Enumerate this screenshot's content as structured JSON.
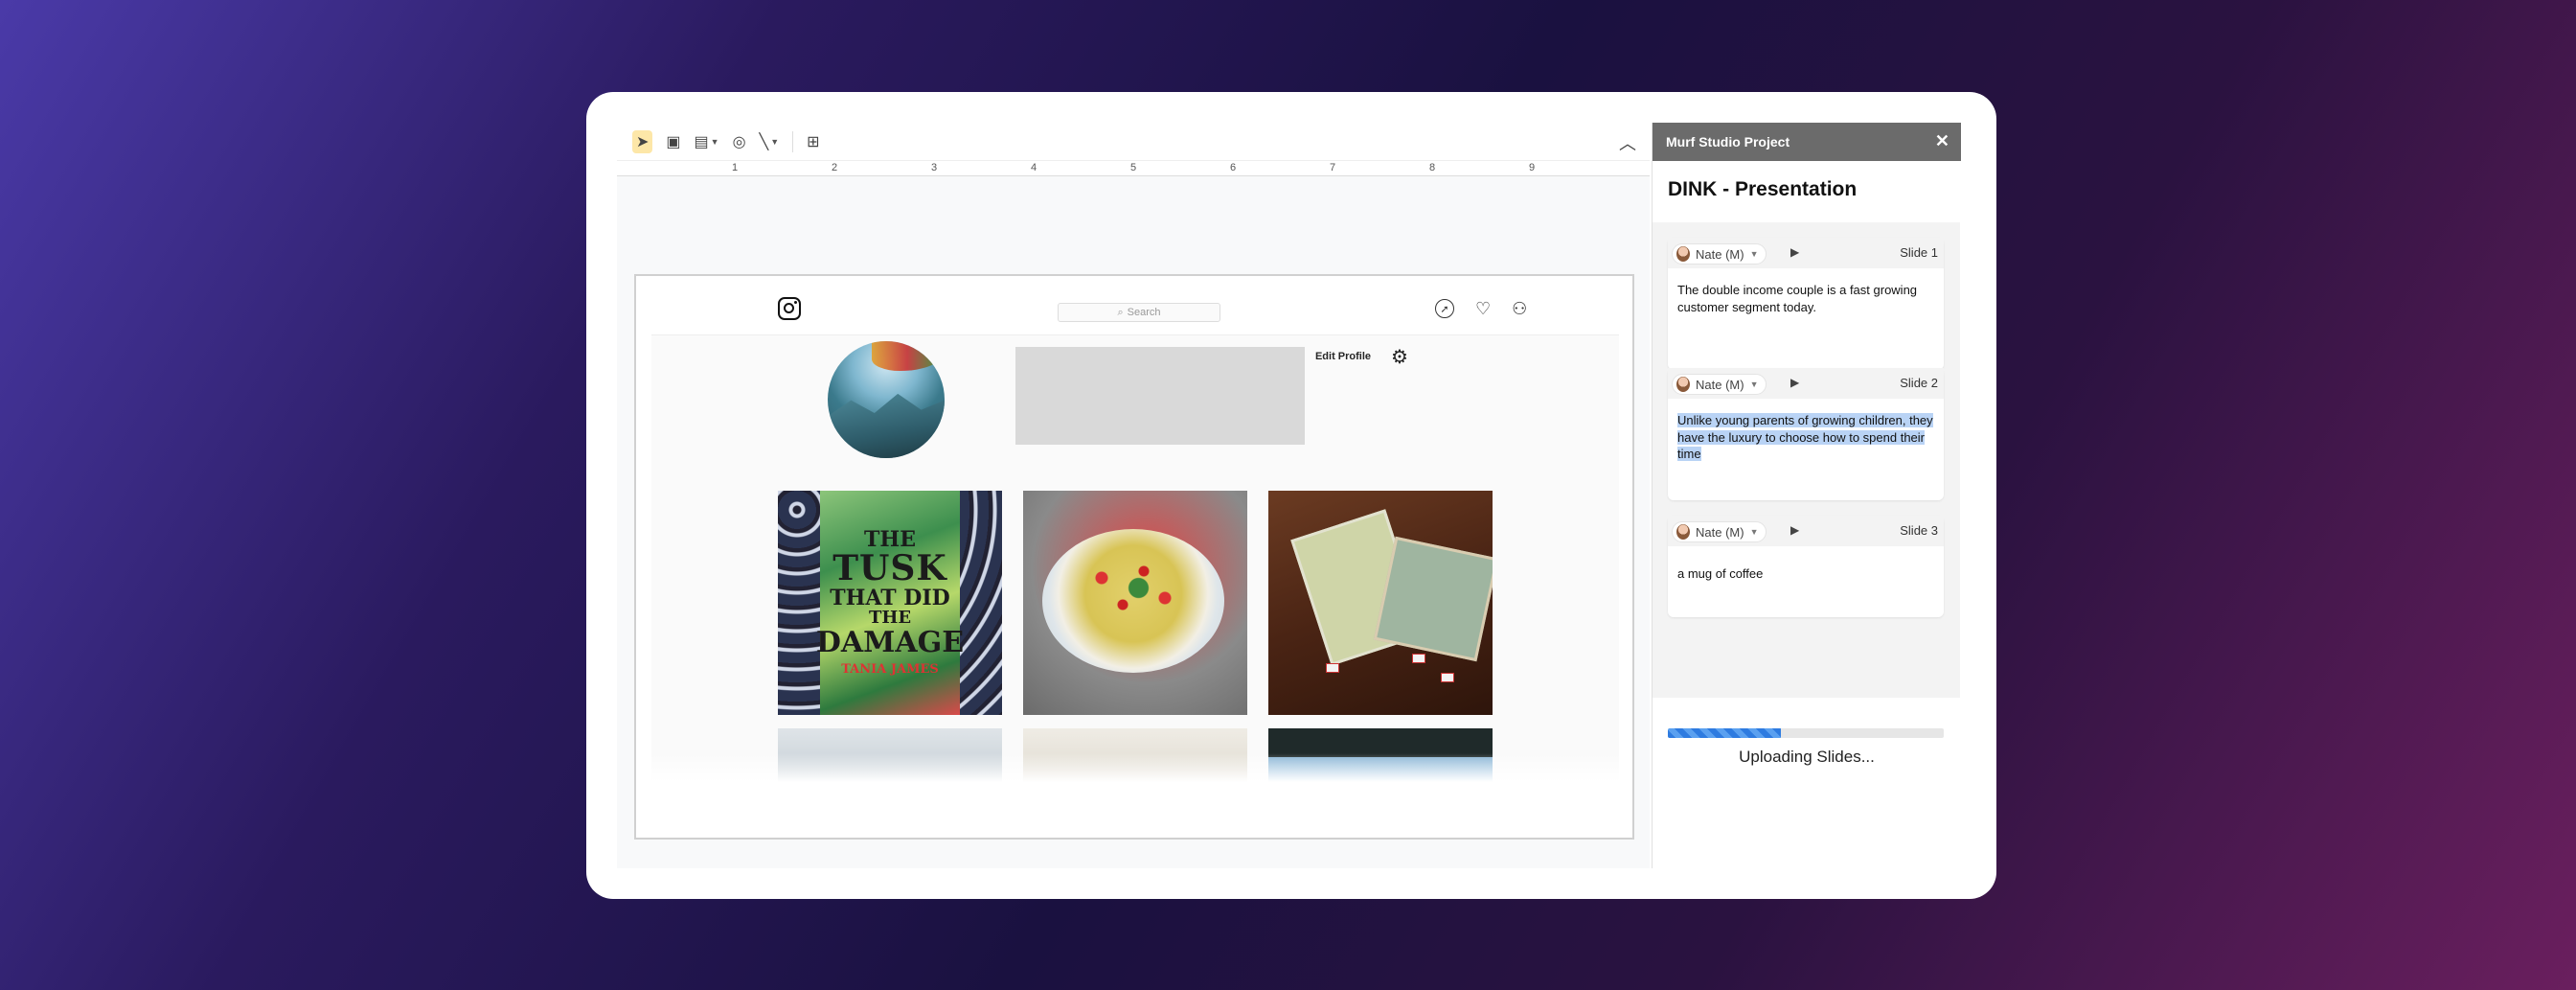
{
  "colors": {
    "accent": "#2e7be0",
    "panel_header": "#6b6b6b",
    "highlight": "#b9d3f5"
  },
  "toolbar": {
    "tools": [
      "select-icon",
      "text-box-icon",
      "image-icon",
      "shapes-icon",
      "line-icon",
      "comment-icon"
    ],
    "collapse_icon": "chevron-up-icon"
  },
  "ruler": {
    "marks": [
      "1",
      "2",
      "3",
      "4",
      "5",
      "6",
      "7",
      "8",
      "9"
    ]
  },
  "instagram": {
    "search_placeholder": "Search",
    "search_icon": "⌕",
    "edit_profile_label": "Edit Profile",
    "book": {
      "line1": "THE",
      "line2": "TUSK",
      "line3": "THAT DID",
      "line4": "THE",
      "line5": "DAMAGE",
      "author": "TANIA JAMES"
    }
  },
  "panel": {
    "header_title": "Murf Studio Project",
    "close_icon": "✕",
    "project_title": "DINK - Presentation",
    "slides": [
      {
        "voice": "Nate (M)",
        "label": "Slide 1",
        "text": "The double income couple is a fast growing customer segment today."
      },
      {
        "voice": "Nate (M)",
        "label": "Slide 2",
        "text": "Unlike young parents of growing children, they have the luxury to choose how to spend their time"
      },
      {
        "voice": "Nate (M)",
        "label": "Slide 3",
        "text": "a mug of coffee"
      }
    ],
    "progress": 0.41,
    "status": "Uploading Slides..."
  }
}
